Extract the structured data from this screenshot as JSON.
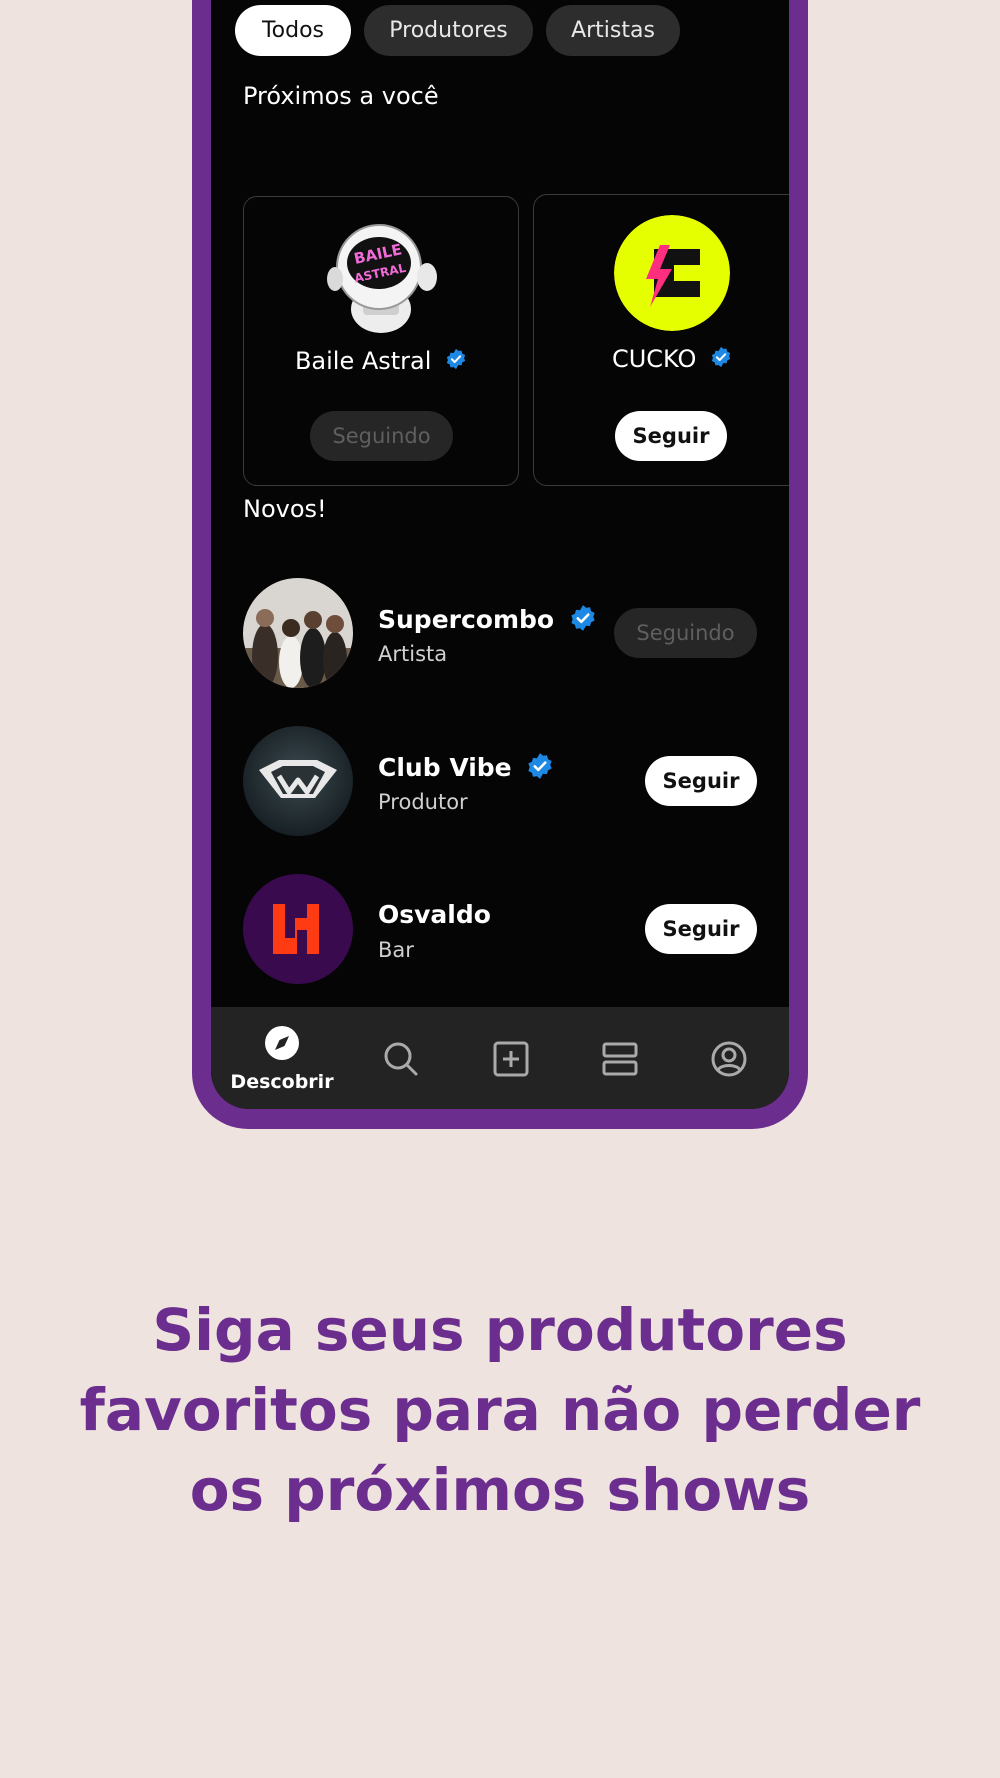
{
  "filters": [
    {
      "label": "Todos",
      "active": true
    },
    {
      "label": "Produtores",
      "active": false
    },
    {
      "label": "Artistas",
      "active": false
    }
  ],
  "nearby": {
    "title": "Próximos a você",
    "cards": [
      {
        "name": "Baile Astral",
        "verified": true,
        "button": "Seguindo",
        "following": true,
        "logo_text": "BAILE ASTRAL"
      },
      {
        "name": "CUCKO",
        "verified": true,
        "button": "Seguir",
        "following": false
      }
    ]
  },
  "new": {
    "title": "Novos!",
    "items": [
      {
        "name": "Supercombo",
        "verified": true,
        "type": "Artista",
        "button": "Seguindo",
        "following": true
      },
      {
        "name": "Club Vibe",
        "verified": true,
        "type": "Produtor",
        "button": "Seguir",
        "following": false
      },
      {
        "name": "Osvaldo",
        "verified": false,
        "type": "Bar",
        "button": "Seguir",
        "following": false
      }
    ]
  },
  "nav": {
    "items": [
      {
        "icon": "compass-icon",
        "label": "Descobrir",
        "active": true
      },
      {
        "icon": "search-icon",
        "label": "",
        "active": false
      },
      {
        "icon": "add-square-icon",
        "label": "",
        "active": false
      },
      {
        "icon": "tickets-icon",
        "label": "",
        "active": false
      },
      {
        "icon": "profile-icon",
        "label": "",
        "active": false
      }
    ]
  },
  "headline": "Siga seus produtores favoritos para não perder os próximos shows",
  "colors": {
    "background": "#EFE3E0",
    "brand_purple": "#6B2E8E",
    "verified_blue": "#1E88E5",
    "cucko_yellow": "#E6FF00"
  }
}
